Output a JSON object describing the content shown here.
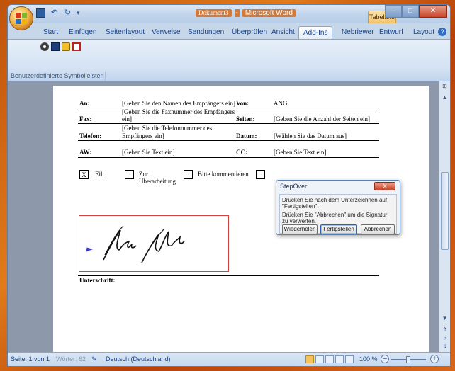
{
  "titlebar": {
    "document_name": "Dokument3",
    "separator": "-",
    "app_name": "Microsoft Word",
    "context_tab": "Tabelle..."
  },
  "tabs": [
    "Start",
    "Einfügen",
    "Seitenlayout",
    "Verweise",
    "Sendungen",
    "Überprüfen",
    "Ansicht",
    "Add-Ins",
    "Nebriewer",
    "Entwurf",
    "Layout"
  ],
  "active_tab": "Add-Ins",
  "ribbon": {
    "group_label": "Benutzerdefinierte Symbolleisten"
  },
  "fax": {
    "an_label": "An:",
    "an_value": "[Geben Sie den Namen des Empfängers ein]",
    "von_label": "Von:",
    "von_value": "ANG",
    "fax_label": "Fax:",
    "fax_value_l1": "[Geben Sie die Faxnummer des Empfängers",
    "fax_value_l2": "ein]",
    "seiten_label": "Seiten:",
    "seiten_value": "[Geben Sie die Anzahl der Seiten ein]",
    "telefon_label": "Telefon:",
    "telefon_value_l1": "[Geben Sie die Telefonnummer des",
    "telefon_value_l2": "Empfängers ein]",
    "datum_label": "Datum:",
    "datum_value": "[Wählen Sie das Datum aus]",
    "aw_label": "AW:",
    "aw_value": "[Geben Sie Text ein]",
    "cc_label": "CC:",
    "cc_value": "[Geben Sie Text ein]",
    "check_eilt_mark": "X",
    "check_eilt": "Eilt",
    "check_zur_l1": "Zur",
    "check_zur_l2": "Überarbeitung",
    "check_komm": "Bitte kommentieren",
    "unterschrift_label": "Unterschrift:"
  },
  "dialog": {
    "title": "StepOver",
    "close_glyph": "X",
    "message1": "Drücken Sie nach dem Unterzeichnen auf \"Fertigstellen\".",
    "message2": "Drücken Sie \"Abbrechen\" um die Signatur zu verwerfen.",
    "btn_repeat": "Wiederholen",
    "btn_finish": "Fertigstellen",
    "btn_cancel": "Abbrechen"
  },
  "statusbar": {
    "page": "Seite: 1 von 1",
    "words": "Wörter: 62",
    "language": "Deutsch (Deutschland)",
    "zoom": "100 %"
  }
}
